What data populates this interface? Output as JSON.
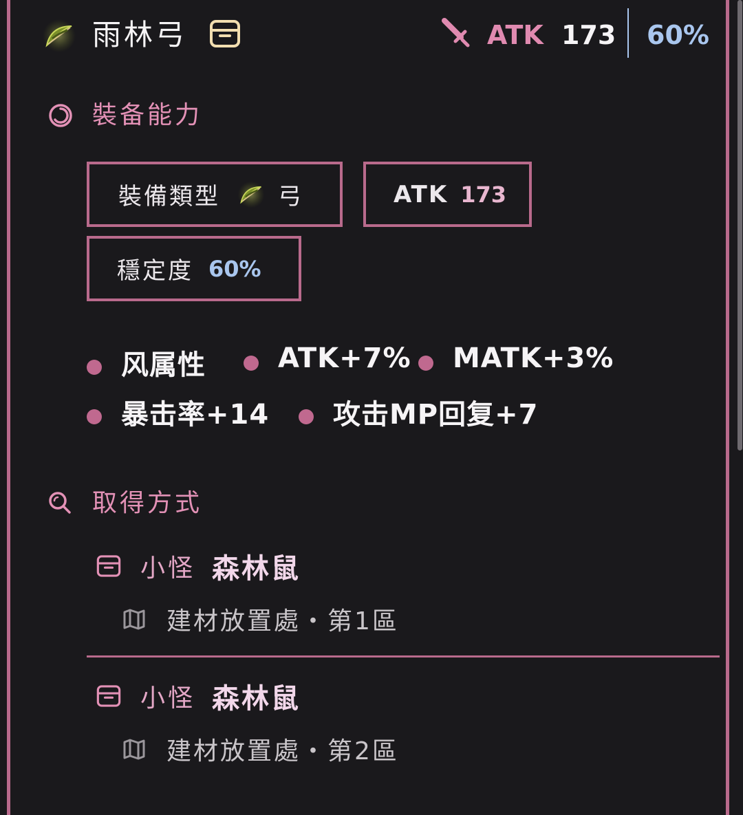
{
  "header": {
    "item_name": "雨林弓",
    "atk_label": "ATK",
    "atk_value": "173",
    "stability": "60%"
  },
  "equip_section": {
    "title": "裝备能力",
    "type_label": "裝備類型",
    "type_value": "弓",
    "atk_label": "ATK",
    "atk_value": "173",
    "stability_label": "穩定度",
    "stability_value": "60%"
  },
  "traits": [
    {
      "text": "风属性"
    },
    {
      "text": "ATK+7%"
    },
    {
      "text": "MATK+3%"
    },
    {
      "text": "暴击率+14"
    },
    {
      "text": "攻击MP回复+7"
    }
  ],
  "obtain_section": {
    "title": "取得方式",
    "sources": [
      {
        "type": "小怪",
        "name": "森林鼠",
        "location": "建材放置處・第1區"
      },
      {
        "type": "小怪",
        "name": "森林鼠",
        "location": "建材放置處・第2區"
      }
    ]
  },
  "icons": {
    "bow": "bow-icon",
    "box": "box-icon",
    "sword": "sword-icon",
    "swirl": "swirl-icon",
    "search": "search-icon",
    "map": "map-icon"
  },
  "colors": {
    "accent": "#b96a8c",
    "pink_text": "#e391b6",
    "blue": "#a9c6ee",
    "background": "#1a191c"
  }
}
